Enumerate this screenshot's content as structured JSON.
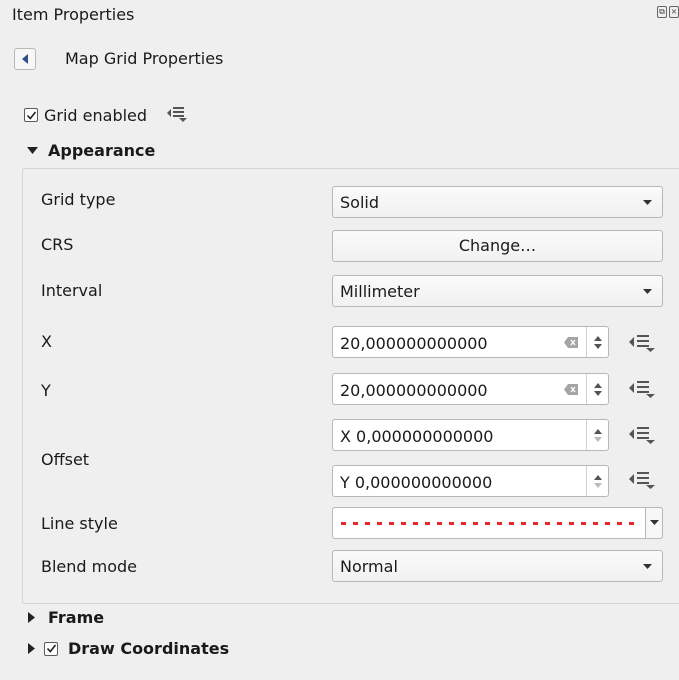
{
  "panel": {
    "title": "Item Properties",
    "header_title": "Map Grid Properties"
  },
  "grid_enabled": {
    "label": "Grid enabled",
    "checked": true
  },
  "appearance": {
    "section_label": "Appearance",
    "grid_type": {
      "label": "Grid type",
      "value": "Solid"
    },
    "crs": {
      "label": "CRS",
      "button_label": "Change…"
    },
    "interval": {
      "label": "Interval",
      "value": "Millimeter"
    },
    "x": {
      "label": "X",
      "value": "20,000000000000"
    },
    "y": {
      "label": "Y",
      "value": "20,000000000000"
    },
    "offset": {
      "label": "Offset",
      "x_value": "X 0,000000000000",
      "y_value": "Y 0,000000000000"
    },
    "line_style": {
      "label": "Line style",
      "color": "#e3272b",
      "pattern": "dashed"
    },
    "blend_mode": {
      "label": "Blend mode",
      "value": "Normal"
    }
  },
  "frame": {
    "section_label": "Frame"
  },
  "draw_coordinates": {
    "section_label": "Draw Coordinates",
    "checked": true
  },
  "icons": {
    "back": "back-arrow-icon",
    "data_defined": "data-defined-override-icon",
    "clear": "clear-icon",
    "dock": [
      "float-icon",
      "close-icon"
    ]
  }
}
